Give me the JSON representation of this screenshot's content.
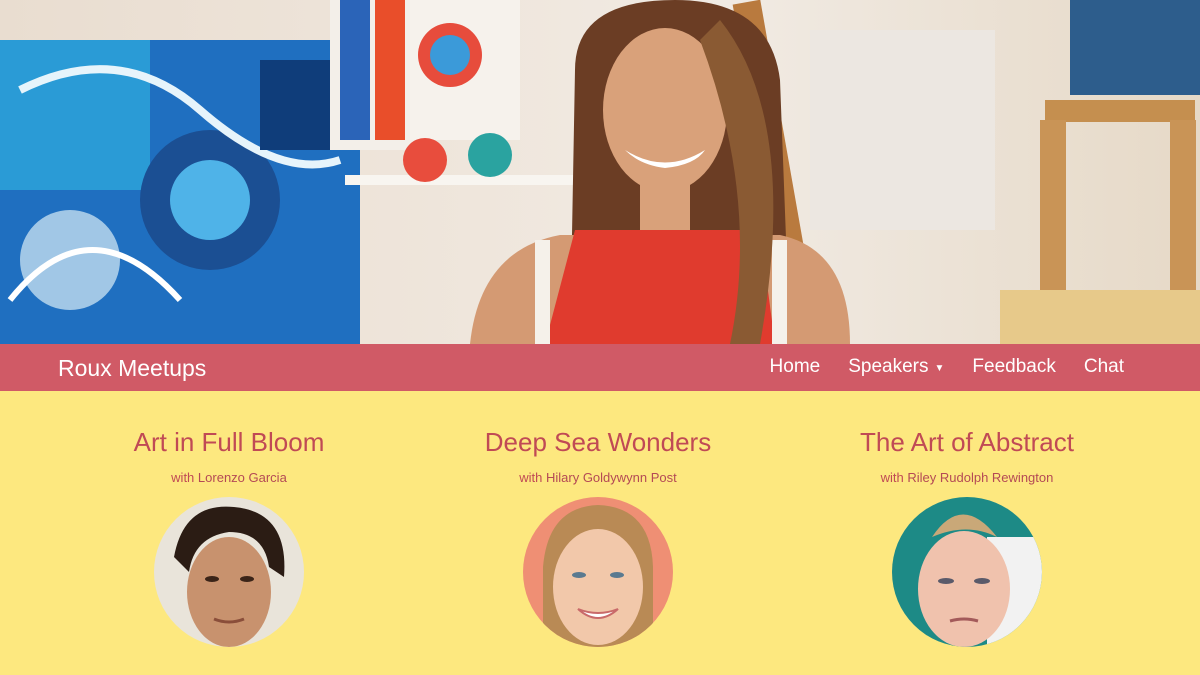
{
  "navbar": {
    "brand": "Roux Meetups",
    "items": [
      {
        "label": "Home"
      },
      {
        "label": "Speakers",
        "has_dropdown": true
      },
      {
        "label": "Feedback"
      },
      {
        "label": "Chat"
      }
    ]
  },
  "events": [
    {
      "title": "Art in Full Bloom",
      "with": "with",
      "speaker": "Lorenzo Garcia"
    },
    {
      "title": "Deep Sea Wonders",
      "with": "with",
      "speaker": "Hilary Goldywynn Post"
    },
    {
      "title": "The Art of Abstract",
      "with": "with",
      "speaker": "Riley Rudolph Rewington"
    }
  ],
  "colors": {
    "navbar": "#d05a66",
    "background": "#fde87f",
    "accent_text": "#c04a55"
  }
}
